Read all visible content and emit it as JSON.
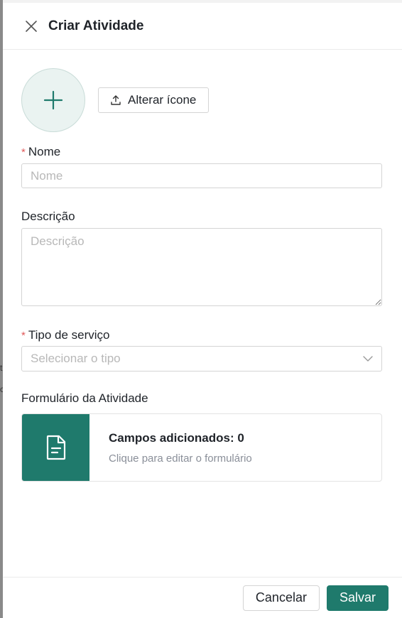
{
  "drawer": {
    "title": "Criar Atividade",
    "icon_button_label": "Alterar ícone"
  },
  "fields": {
    "name": {
      "label": "Nome",
      "placeholder": "Nome",
      "required": true
    },
    "description": {
      "label": "Descrição",
      "placeholder": "Descrição"
    },
    "service_type": {
      "label": "Tipo de serviço",
      "placeholder": "Selecionar o tipo",
      "required": true
    }
  },
  "form_section": {
    "label": "Formulário da Atividade",
    "fields_added": "Campos adicionados: 0",
    "hint": "Clique para editar o formulário"
  },
  "footer": {
    "cancel_label": "Cancelar",
    "save_label": "Salvar"
  },
  "colors": {
    "accent": "#1f7a6c",
    "required_marker": "#e05a5a"
  },
  "backdrop": {
    "glyph_1": "t",
    "glyph_2": "c"
  }
}
